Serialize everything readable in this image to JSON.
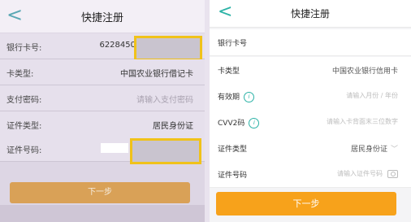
{
  "left": {
    "title": "快捷注册",
    "back_glyph": "<",
    "rows": [
      {
        "label": "银行卡号:",
        "value": "6228450"
      },
      {
        "label": "卡类型:",
        "value": "中国农业银行借记卡"
      },
      {
        "label": "支付密码:",
        "placeholder": "请输入支付密码"
      },
      {
        "label": "证件类型:",
        "value": "居民身份证"
      },
      {
        "label": "证件号码:",
        "value": ""
      }
    ],
    "next_button": "下一步"
  },
  "right": {
    "title": "快捷注册",
    "back_glyph": "<",
    "rows": [
      {
        "label": "银行卡号"
      },
      {
        "label": "卡类型",
        "value": "中国农业银行信用卡"
      },
      {
        "label": "有效期",
        "placeholder": "请输入月份 / 年份"
      },
      {
        "label": "CVV2码",
        "placeholder": "请输入卡背面末三位数字"
      },
      {
        "label": "证件类型",
        "value": "居民身份证"
      },
      {
        "label": "证件号码",
        "placeholder": "请输入证件号码"
      }
    ],
    "next_button": "下一步",
    "accent": "#2bb2a6",
    "button_color": "#f7a21b"
  }
}
